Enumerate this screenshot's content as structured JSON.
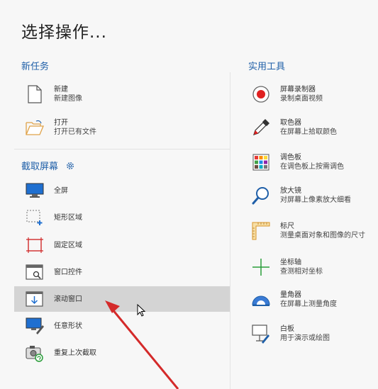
{
  "page": {
    "title": "选择操作..."
  },
  "new_task": {
    "header": "新任务",
    "items": [
      {
        "label": "新建",
        "sub": "新建图像",
        "icon": "new-document-icon"
      },
      {
        "label": "打开",
        "sub": "打开已有文件",
        "icon": "open-folder-icon"
      }
    ]
  },
  "capture": {
    "header": "截取屏幕",
    "settings_icon": "gear-icon",
    "items": [
      {
        "label": "全屏",
        "icon": "monitor-icon"
      },
      {
        "label": "矩形区域",
        "icon": "rectangle-region-icon"
      },
      {
        "label": "固定区域",
        "icon": "fixed-region-icon"
      },
      {
        "label": "窗口控件",
        "icon": "window-control-icon"
      },
      {
        "label": "滚动窗口",
        "icon": "scroll-window-icon",
        "selected": true
      },
      {
        "label": "任意形状",
        "icon": "freeform-icon"
      },
      {
        "label": "重复上次截取",
        "icon": "repeat-camera-icon"
      }
    ]
  },
  "tools": {
    "header": "实用工具",
    "items": [
      {
        "label": "屏幕录制器",
        "sub": "录制桌面视频",
        "icon": "record-icon"
      },
      {
        "label": "取色器",
        "sub": "在屏幕上拾取颜色",
        "icon": "eyedropper-icon"
      },
      {
        "label": "调色板",
        "sub": "在调色板上按需调色",
        "icon": "palette-icon"
      },
      {
        "label": "放大镜",
        "sub": "对屏幕上像素放大细看",
        "icon": "magnifier-icon"
      },
      {
        "label": "标尺",
        "sub": "测量桌面对象和图像的尺寸",
        "icon": "ruler-icon"
      },
      {
        "label": "坐标轴",
        "sub": "查测相对坐标",
        "icon": "crosshair-icon"
      },
      {
        "label": "量角器",
        "sub": "在屏幕上测量角度",
        "icon": "protractor-icon"
      },
      {
        "label": "白板",
        "sub": "用于演示或绘图",
        "icon": "whiteboard-icon"
      }
    ]
  },
  "colors": {
    "accent": "#1f5fa8",
    "selected_bg": "#d4d4d4",
    "annotation_arrow": "#d42a2a"
  }
}
